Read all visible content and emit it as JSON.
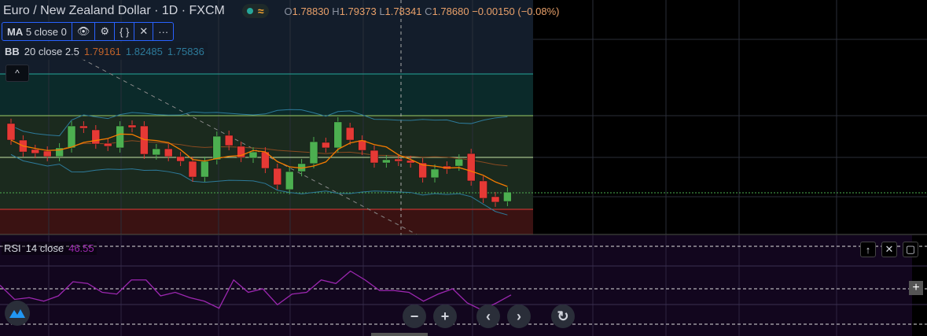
{
  "header": {
    "title": "Euro / New Zealand Dollar · 1D · FXCM",
    "o_label": "O",
    "o": "1.78830",
    "h_label": "H",
    "h": "1.79373",
    "l_label": "L",
    "l": "1.78341",
    "c_label": "C",
    "c": "1.78680",
    "change": "−0.00150 (−0.08%)"
  },
  "ma": {
    "label": "MA",
    "params": "5 close 0"
  },
  "bb": {
    "label": "BB",
    "params": "20 close 2.5",
    "basis": "1.79161",
    "upper": "1.82485",
    "lower": "1.75836"
  },
  "rsi": {
    "label": "RSI",
    "params": "14 close",
    "value": "46.55"
  },
  "colors": {
    "up": "#4caf50",
    "down": "#e53935",
    "ma": "#f57c00",
    "bb": "#2d7a9a",
    "rsi": "#9c27b0"
  },
  "candles": [
    [
      1.8348,
      1.8233
    ],
    [
      1.8233,
      1.8151
    ],
    [
      1.8168,
      1.8141
    ],
    [
      1.8157,
      1.8119
    ],
    [
      1.8119,
      1.8179
    ],
    [
      1.8179,
      1.8331
    ],
    [
      1.8331,
      1.8315
    ],
    [
      1.8304,
      1.8206
    ],
    [
      1.8211,
      1.819
    ],
    [
      1.8179,
      1.8331
    ],
    [
      1.8337,
      1.832
    ],
    [
      1.8331,
      1.8135
    ],
    [
      1.813,
      1.8173
    ],
    [
      1.8173,
      1.8119
    ],
    [
      1.8119,
      1.8086
    ],
    [
      1.8086,
      1.7977
    ],
    [
      1.7977,
      1.8086
    ],
    [
      1.8097,
      1.826
    ],
    [
      1.8266,
      1.8195
    ],
    [
      1.819,
      1.8113
    ],
    [
      1.8108,
      1.8151
    ],
    [
      1.8151,
      1.8037
    ],
    [
      1.8037,
      1.7923
    ],
    [
      1.789,
      1.8015
    ],
    [
      1.8015,
      1.807
    ],
    [
      1.807,
      1.8222
    ],
    [
      1.8217,
      1.8179
    ],
    [
      1.8179,
      1.8359
    ],
    [
      1.832,
      1.8233
    ],
    [
      1.8233,
      1.8162
    ],
    [
      1.8162,
      1.8075
    ],
    [
      1.8075,
      1.8097
    ],
    [
      1.8102,
      1.8086
    ],
    [
      1.8092,
      1.8075
    ],
    [
      1.8075,
      1.7972
    ],
    [
      1.7972,
      1.8032
    ],
    [
      1.8053,
      1.8032
    ],
    [
      1.8053,
      1.8102
    ],
    [
      1.814,
      1.795
    ],
    [
      1.795,
      1.783
    ],
    [
      1.7841,
      1.7803
    ],
    [
      1.7808,
      1.7873
    ]
  ],
  "rsi_values": [
    52,
    44,
    45,
    43,
    46,
    54,
    53,
    48,
    47,
    55,
    55,
    46,
    48,
    45,
    43,
    39,
    55,
    48,
    50,
    41,
    47,
    48,
    55,
    53,
    60,
    55,
    49,
    49,
    48,
    43,
    47,
    50,
    42,
    38,
    42,
    46.55
  ],
  "nav": {
    "zoom_out": "−",
    "zoom_in": "+",
    "left": "‹",
    "right": "›",
    "reset": "↻"
  },
  "pane_buttons": {
    "up": "↑",
    "close": "✕",
    "max": "▢"
  },
  "collapse": "^"
}
